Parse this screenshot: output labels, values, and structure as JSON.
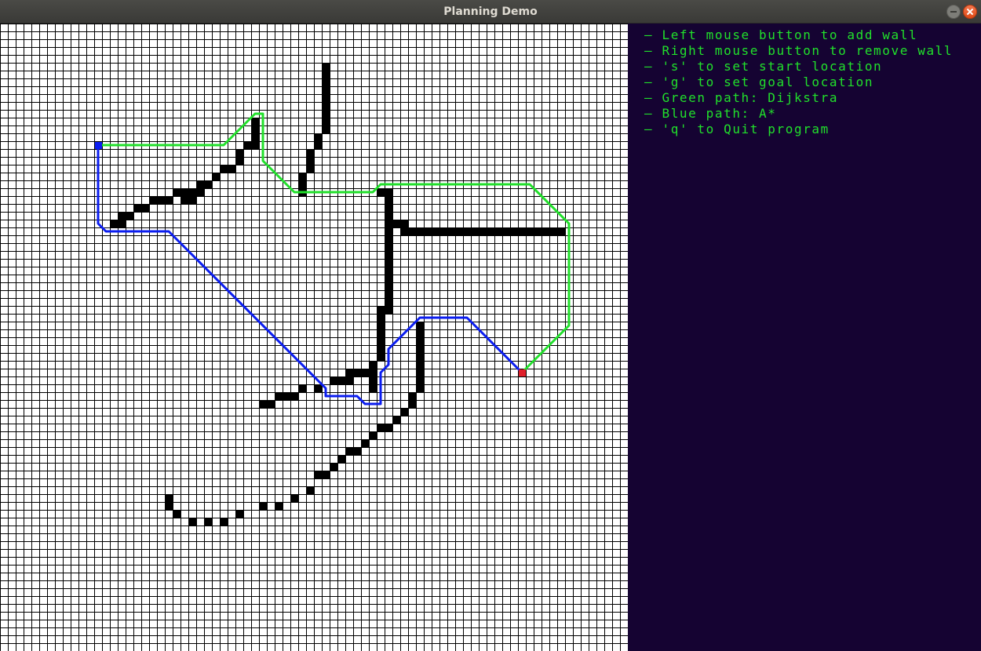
{
  "window": {
    "title": "Planning Demo",
    "controls": [
      "minimize",
      "close"
    ]
  },
  "grid": {
    "cols": 80,
    "rows": 80,
    "background": "#ffffff",
    "grid_line_color": "#000000",
    "wall_color": "#000000",
    "walls": [
      [
        41,
        5
      ],
      [
        41,
        6
      ],
      [
        41,
        7
      ],
      [
        41,
        8
      ],
      [
        41,
        9
      ],
      [
        41,
        10
      ],
      [
        41,
        11
      ],
      [
        41,
        12
      ],
      [
        41,
        13
      ],
      [
        40,
        14
      ],
      [
        40,
        15
      ],
      [
        39,
        16
      ],
      [
        39,
        17
      ],
      [
        39,
        18
      ],
      [
        38,
        19
      ],
      [
        38,
        20
      ],
      [
        38,
        21
      ],
      [
        32,
        12
      ],
      [
        32,
        13
      ],
      [
        32,
        14
      ],
      [
        32,
        15
      ],
      [
        31,
        15
      ],
      [
        30,
        16
      ],
      [
        30,
        17
      ],
      [
        29,
        18
      ],
      [
        28,
        18
      ],
      [
        27,
        19
      ],
      [
        26,
        20
      ],
      [
        25,
        20
      ],
      [
        25,
        21
      ],
      [
        24,
        21
      ],
      [
        23,
        21
      ],
      [
        22,
        21
      ],
      [
        24,
        22
      ],
      [
        23,
        22
      ],
      [
        21,
        22
      ],
      [
        20,
        22
      ],
      [
        19,
        22
      ],
      [
        18,
        23
      ],
      [
        17,
        23
      ],
      [
        16,
        24
      ],
      [
        15,
        24
      ],
      [
        14,
        25
      ],
      [
        15,
        25
      ],
      [
        48,
        21
      ],
      [
        49,
        21
      ],
      [
        49,
        22
      ],
      [
        49,
        23
      ],
      [
        49,
        24
      ],
      [
        49,
        25
      ],
      [
        50,
        25
      ],
      [
        51,
        25
      ],
      [
        51,
        26
      ],
      [
        52,
        26
      ],
      [
        53,
        26
      ],
      [
        54,
        26
      ],
      [
        55,
        26
      ],
      [
        56,
        26
      ],
      [
        57,
        26
      ],
      [
        58,
        26
      ],
      [
        59,
        26
      ],
      [
        60,
        26
      ],
      [
        61,
        26
      ],
      [
        62,
        26
      ],
      [
        63,
        26
      ],
      [
        64,
        26
      ],
      [
        65,
        26
      ],
      [
        66,
        26
      ],
      [
        67,
        26
      ],
      [
        68,
        26
      ],
      [
        69,
        26
      ],
      [
        70,
        26
      ],
      [
        71,
        26
      ],
      [
        49,
        26
      ],
      [
        49,
        27
      ],
      [
        49,
        28
      ],
      [
        49,
        29
      ],
      [
        49,
        30
      ],
      [
        49,
        31
      ],
      [
        49,
        32
      ],
      [
        49,
        33
      ],
      [
        49,
        34
      ],
      [
        49,
        35
      ],
      [
        49,
        36
      ],
      [
        48,
        36
      ],
      [
        48,
        37
      ],
      [
        48,
        38
      ],
      [
        48,
        39
      ],
      [
        48,
        40
      ],
      [
        48,
        41
      ],
      [
        48,
        42
      ],
      [
        47,
        43
      ],
      [
        47,
        44
      ],
      [
        47,
        45
      ],
      [
        47,
        46
      ],
      [
        46,
        44
      ],
      [
        45,
        44
      ],
      [
        44,
        44
      ],
      [
        44,
        45
      ],
      [
        43,
        45
      ],
      [
        42,
        45
      ],
      [
        40,
        46
      ],
      [
        38,
        46
      ],
      [
        37,
        47
      ],
      [
        36,
        47
      ],
      [
        35,
        47
      ],
      [
        34,
        48
      ],
      [
        33,
        48
      ],
      [
        53,
        38
      ],
      [
        53,
        39
      ],
      [
        53,
        40
      ],
      [
        53,
        41
      ],
      [
        53,
        42
      ],
      [
        53,
        43
      ],
      [
        53,
        44
      ],
      [
        53,
        45
      ],
      [
        53,
        46
      ],
      [
        52,
        47
      ],
      [
        52,
        48
      ],
      [
        51,
        49
      ],
      [
        50,
        50
      ],
      [
        49,
        51
      ],
      [
        48,
        51
      ],
      [
        47,
        52
      ],
      [
        46,
        53
      ],
      [
        45,
        54
      ],
      [
        44,
        54
      ],
      [
        43,
        55
      ],
      [
        42,
        56
      ],
      [
        41,
        57
      ],
      [
        40,
        57
      ],
      [
        39,
        59
      ],
      [
        37,
        60
      ],
      [
        35,
        61
      ],
      [
        33,
        61
      ],
      [
        30,
        62
      ],
      [
        28,
        63
      ],
      [
        26,
        63
      ],
      [
        24,
        63
      ],
      [
        22,
        62
      ],
      [
        21,
        61
      ],
      [
        21,
        60
      ]
    ]
  },
  "paths": [
    {
      "algorithm": "Dijkstra",
      "color": "#21e02b",
      "cells": [
        [
          12.5,
          15.5
        ],
        [
          28.5,
          15.5
        ],
        [
          32.5,
          11.5
        ],
        [
          33.5,
          11.5
        ],
        [
          33.5,
          17.5
        ],
        [
          37.5,
          21.5
        ],
        [
          47.5,
          21.5
        ],
        [
          48.5,
          20.5
        ],
        [
          67.5,
          20.5
        ],
        [
          72.5,
          25.5
        ],
        [
          72.5,
          38.5
        ],
        [
          66.5,
          44.5
        ]
      ]
    },
    {
      "algorithm": "A*",
      "color": "#0b1df0",
      "cells": [
        [
          12.5,
          15.5
        ],
        [
          12.5,
          25.5
        ],
        [
          13.5,
          26.5
        ],
        [
          21.5,
          26.5
        ],
        [
          41.5,
          46.5
        ],
        [
          41.5,
          47.5
        ],
        [
          45.5,
          47.5
        ],
        [
          46.5,
          48.5
        ],
        [
          48.5,
          48.5
        ],
        [
          48.5,
          44.5
        ],
        [
          49.5,
          43.5
        ],
        [
          49.5,
          41.5
        ],
        [
          53.5,
          37.5
        ],
        [
          59.5,
          37.5
        ],
        [
          66.5,
          44.5
        ]
      ]
    }
  ],
  "start": {
    "col": 12,
    "row": 15,
    "color": "#0b1df0"
  },
  "goal": {
    "col": 66,
    "row": 44,
    "color": "#e0202b"
  },
  "panel": {
    "background": "#150332",
    "text_color": "#21e02b",
    "instructions": [
      "— Left mouse button to add wall",
      "— Right mouse button to remove wall",
      "— 's' to set start location",
      "— 'g' to set goal location",
      "— Green path: Dijkstra",
      "— Blue path: A*",
      "— 'q' to Quit program"
    ]
  }
}
